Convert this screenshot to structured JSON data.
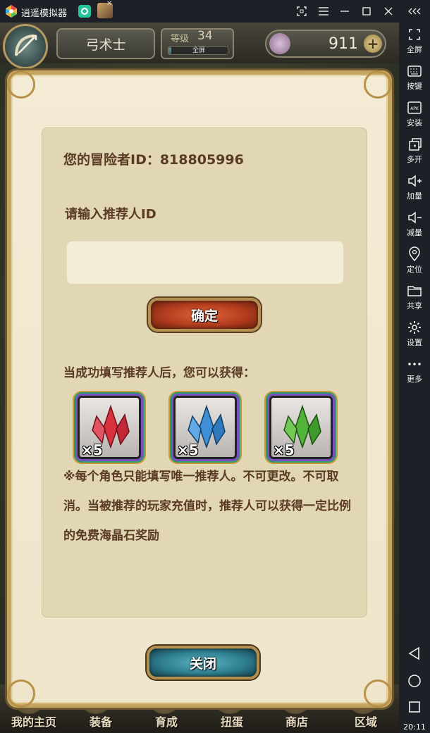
{
  "window": {
    "title": "逍遥模拟器"
  },
  "sidebar": {
    "items": [
      {
        "label": "全屏",
        "icon": "fullscreen-icon"
      },
      {
        "label": "按键",
        "icon": "keyboard-icon"
      },
      {
        "label": "安装",
        "icon": "apk-install-icon"
      },
      {
        "label": "多开",
        "icon": "multi-instance-icon"
      },
      {
        "label": "加量",
        "icon": "volume-up-icon"
      },
      {
        "label": "减量",
        "icon": "volume-down-icon"
      },
      {
        "label": "定位",
        "icon": "location-icon"
      },
      {
        "label": "共享",
        "icon": "folder-icon"
      },
      {
        "label": "设置",
        "icon": "gear-icon"
      },
      {
        "label": "更多",
        "icon": "more-icon"
      }
    ],
    "apk_text": "APK",
    "time": "20:11"
  },
  "game": {
    "class_name": "弓术士",
    "level_label": "等级",
    "level": "34",
    "exp_label": "全屏",
    "exp_fraction": 0.05,
    "gems": "911",
    "bottom_nav": [
      "我的主页",
      "装备",
      "育成",
      "扭蛋",
      "商店",
      "区域"
    ]
  },
  "dialog": {
    "adventurer_id": "您的冒险者ID：818805996",
    "referrer_label": "请输入推荐人ID",
    "referrer_input_value": "",
    "confirm_label": "确定",
    "reward_intro": "当成功填写推荐人后，您可以获得：",
    "rewards": [
      {
        "qty": "×5",
        "color": "#d8323f"
      },
      {
        "qty": "×5",
        "color": "#3f8fd6"
      },
      {
        "qty": "×5",
        "color": "#52b33a"
      }
    ],
    "note": "※每个角色只能填写唯一推荐人。不可更改。不可取消。当被推荐的玩家充值时，推荐人可以获得一定比例的免费海晶石奖励",
    "close_label": "关闭"
  }
}
